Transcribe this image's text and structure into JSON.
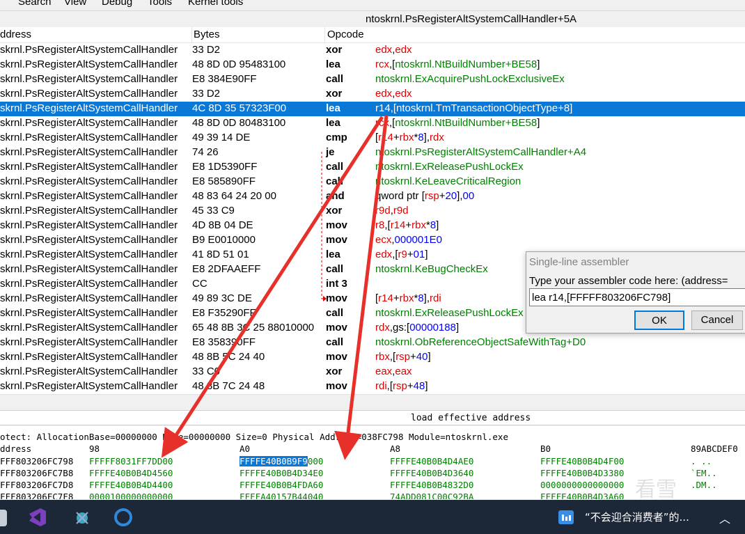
{
  "menu": [
    "Search",
    "View",
    "Debug",
    "Tools",
    "Kernel tools"
  ],
  "title": "ntoskrnl.PsRegisterAltSystemCallHandler+5A",
  "columns": {
    "address": "ddress",
    "bytes": "Bytes",
    "opcode": "Opcode"
  },
  "rows": [
    {
      "addr": "skrnl.PsRegisterAltSystemCallHandler",
      "bytes": "33 D2",
      "mn": "xor",
      "op": [
        [
          "r",
          "edx"
        ],
        [
          "k",
          ","
        ],
        [
          "r",
          "edx"
        ]
      ]
    },
    {
      "addr": "skrnl.PsRegisterAltSystemCallHandler",
      "bytes": "48 8D 0D 95483100",
      "mn": "lea",
      "op": [
        [
          "r",
          "rcx"
        ],
        [
          "k",
          ",["
        ],
        [
          "g",
          "ntoskrnl.NtBuildNumber+BE58"
        ],
        [
          "k",
          "]"
        ]
      ]
    },
    {
      "addr": "skrnl.PsRegisterAltSystemCallHandler",
      "bytes": "E8 384E90FF",
      "mn": "call",
      "op": [
        [
          "g",
          "ntoskrnl.ExAcquirePushLockExclusiveEx"
        ]
      ]
    },
    {
      "addr": "skrnl.PsRegisterAltSystemCallHandler",
      "bytes": "33 D2",
      "mn": "xor",
      "op": [
        [
          "r",
          "edx"
        ],
        [
          "k",
          ","
        ],
        [
          "r",
          "edx"
        ]
      ]
    },
    {
      "addr": "skrnl.PsRegisterAltSystemCallHandler",
      "bytes": "4C 8D 35 57323F00",
      "mn": "lea",
      "sel": true,
      "op": [
        [
          "r",
          "r14"
        ],
        [
          "k",
          ",["
        ],
        [
          "g",
          "ntoskrnl.TmTransactionObjectType+8"
        ],
        [
          "k",
          "]"
        ]
      ]
    },
    {
      "addr": "skrnl.PsRegisterAltSystemCallHandler",
      "bytes": "48 8D 0D 80483100",
      "mn": "lea",
      "op": [
        [
          "r",
          "rcx"
        ],
        [
          "k",
          ",["
        ],
        [
          "g",
          "ntoskrnl.NtBuildNumber+BE58"
        ],
        [
          "k",
          "]"
        ]
      ]
    },
    {
      "addr": "skrnl.PsRegisterAltSystemCallHandler",
      "bytes": "49 39 14 DE",
      "mn": "cmp",
      "op": [
        [
          "k",
          "["
        ],
        [
          "r",
          "r14"
        ],
        [
          "k",
          "+"
        ],
        [
          "r",
          "rbx"
        ],
        [
          "k",
          "*"
        ],
        [
          "b",
          "8"
        ],
        [
          "k",
          "],"
        ],
        [
          "r",
          "rdx"
        ]
      ]
    },
    {
      "addr": "skrnl.PsRegisterAltSystemCallHandler",
      "bytes": "74 26",
      "mn": "je",
      "op": [
        [
          "g",
          "ntoskrnl.PsRegisterAltSystemCallHandler+A4"
        ]
      ]
    },
    {
      "addr": "skrnl.PsRegisterAltSystemCallHandler",
      "bytes": "E8 1D5390FF",
      "mn": "call",
      "op": [
        [
          "g",
          "ntoskrnl.ExReleasePushLockEx"
        ]
      ]
    },
    {
      "addr": "skrnl.PsRegisterAltSystemCallHandler",
      "bytes": "E8 585890FF",
      "mn": "call",
      "op": [
        [
          "g",
          "ntoskrnl.KeLeaveCriticalRegion"
        ]
      ]
    },
    {
      "addr": "skrnl.PsRegisterAltSystemCallHandler",
      "bytes": "48 83 64 24 20 00",
      "mn": "and",
      "op": [
        [
          "k",
          "qword ptr ["
        ],
        [
          "r",
          "rsp"
        ],
        [
          "k",
          "+"
        ],
        [
          "b",
          "20"
        ],
        [
          "k",
          "],"
        ],
        [
          "b",
          "00"
        ]
      ]
    },
    {
      "addr": "skrnl.PsRegisterAltSystemCallHandler",
      "bytes": "45 33 C9",
      "mn": "xor",
      "op": [
        [
          "r",
          "r9d"
        ],
        [
          "k",
          ","
        ],
        [
          "r",
          "r9d"
        ]
      ]
    },
    {
      "addr": "skrnl.PsRegisterAltSystemCallHandler",
      "bytes": "4D 8B 04 DE",
      "mn": "mov",
      "op": [
        [
          "r",
          "r8"
        ],
        [
          "k",
          ",["
        ],
        [
          "r",
          "r14"
        ],
        [
          "k",
          "+"
        ],
        [
          "r",
          "rbx"
        ],
        [
          "k",
          "*"
        ],
        [
          "b",
          "8"
        ],
        [
          "k",
          "]"
        ]
      ]
    },
    {
      "addr": "skrnl.PsRegisterAltSystemCallHandler",
      "bytes": "B9 E0010000",
      "mn": "mov",
      "op": [
        [
          "r",
          "ecx"
        ],
        [
          "k",
          ","
        ],
        [
          "b",
          "000001E0"
        ]
      ]
    },
    {
      "addr": "skrnl.PsRegisterAltSystemCallHandler",
      "bytes": "41 8D 51 01",
      "mn": "lea",
      "op": [
        [
          "r",
          "edx"
        ],
        [
          "k",
          ",["
        ],
        [
          "r",
          "r9"
        ],
        [
          "k",
          "+"
        ],
        [
          "b",
          "01"
        ],
        [
          "k",
          "]"
        ]
      ]
    },
    {
      "addr": "skrnl.PsRegisterAltSystemCallHandler",
      "bytes": "E8 2DFAAEFF",
      "mn": "call",
      "op": [
        [
          "g",
          "ntoskrnl.KeBugCheckEx"
        ]
      ]
    },
    {
      "addr": "skrnl.PsRegisterAltSystemCallHandler",
      "bytes": "CC",
      "mn": "int 3",
      "op": []
    },
    {
      "addr": "skrnl.PsRegisterAltSystemCallHandler",
      "bytes": "49 89 3C DE",
      "mn": "mov",
      "op": [
        [
          "k",
          "["
        ],
        [
          "r",
          "r14"
        ],
        [
          "k",
          "+"
        ],
        [
          "r",
          "rbx"
        ],
        [
          "k",
          "*"
        ],
        [
          "b",
          "8"
        ],
        [
          "k",
          "],"
        ],
        [
          "r",
          "rdi"
        ]
      ]
    },
    {
      "addr": "skrnl.PsRegisterAltSystemCallHandler",
      "bytes": "E8 F35290FF",
      "mn": "call",
      "op": [
        [
          "g",
          "ntoskrnl.ExReleasePushLockEx"
        ]
      ]
    },
    {
      "addr": "skrnl.PsRegisterAltSystemCallHandler",
      "bytes": "65 48 8B 3C 25 88010000",
      "mn": "mov",
      "op": [
        [
          "r",
          "rdx"
        ],
        [
          "k",
          ",gs:["
        ],
        [
          "b",
          "00000188"
        ],
        [
          "k",
          "]"
        ]
      ]
    },
    {
      "addr": "skrnl.PsRegisterAltSystemCallHandler",
      "bytes": "E8 358390FF",
      "mn": "call",
      "op": [
        [
          "g",
          "ntoskrnl.ObReferenceObjectSafeWithTag+D0"
        ]
      ]
    },
    {
      "addr": "skrnl.PsRegisterAltSystemCallHandler",
      "bytes": "48 8B 5C 24 40",
      "mn": "mov",
      "op": [
        [
          "r",
          "rbx"
        ],
        [
          "k",
          ",["
        ],
        [
          "r",
          "rsp"
        ],
        [
          "k",
          "+"
        ],
        [
          "b",
          "40"
        ],
        [
          "k",
          "]"
        ]
      ]
    },
    {
      "addr": "skrnl.PsRegisterAltSystemCallHandler",
      "bytes": "33 C0",
      "mn": "xor",
      "op": [
        [
          "r",
          "eax"
        ],
        [
          "k",
          ","
        ],
        [
          "r",
          "eax"
        ]
      ]
    },
    {
      "addr": "skrnl.PsRegisterAltSystemCallHandler",
      "bytes": "48 8B 7C 24 48",
      "mn": "mov",
      "op": [
        [
          "r",
          "rdi"
        ],
        [
          "k",
          ",["
        ],
        [
          "r",
          "rsp"
        ],
        [
          "k",
          "+"
        ],
        [
          "b",
          "48"
        ],
        [
          "k",
          "]"
        ]
      ]
    }
  ],
  "status": "load effective address",
  "memory": {
    "info": "otect: AllocationBase=00000000 Base=00000000 Size=0 Physical Address=038FC798 Module=ntoskrnl.exe",
    "headers": [
      "ddress",
      "98",
      "A0",
      "A8",
      "B0",
      "89ABCDEF0"
    ],
    "lines": [
      {
        "addr": "FFF803206FC798",
        "c1": "FFFFF8031FF7DD00",
        "c2a": "FFFFE40B0B9F9",
        "c2b": "000",
        "c3": "FFFFE40B0B4D4AE0",
        "c4": "FFFFE40B0B4D4F00",
        "asc": ".  ..  "
      },
      {
        "addr": "FFF803206FC7B8",
        "c1": "FFFFE40B0B4D4560",
        "c2": "FFFFE40B0B4D34E0",
        "c3": "FFFFE40B0B4D3640",
        "c4": "FFFFE40B0B4D3380",
        "asc": "`EM.."
      },
      {
        "addr": "FFF803206FC7D8",
        "c1": "FFFFE40B0B4D4400",
        "c2": "FFFFE40B0B4FDA60",
        "c3": "FFFFE40B0B4832D0",
        "c4": "0000000000000000",
        "asc": ".DM.."
      },
      {
        "addr": "FFF803206FC7F8",
        "c1": "0000100000000000",
        "c2": "FFFFA40157B44040",
        "c3": "74ADD081C00C92BA",
        "c4": "FFFFE40B0B4D3A60",
        "asc": ""
      }
    ]
  },
  "dialog": {
    "title": "Single-line assembler",
    "prompt": "Type your assembler code here: (address=",
    "value": "lea r14,[FFFFF803206FC798]",
    "ok": "OK",
    "cancel": "Cancel"
  },
  "taskbar": {
    "notification": "“不会迎合消费者”的...",
    "watermark": "看雪"
  },
  "colors": {
    "selection": "#0a78d7",
    "register": "#e00000",
    "symbol": "#008000",
    "immediate": "#0000ff",
    "arrow": "#e8302a"
  }
}
